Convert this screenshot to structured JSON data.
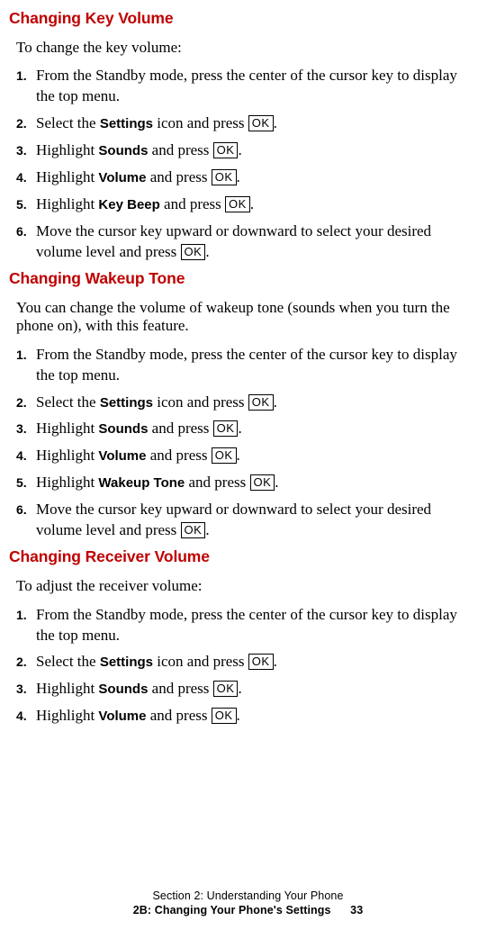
{
  "button_label": "OK",
  "sections": [
    {
      "heading": "Changing Key Volume",
      "intro": "To change the key volume:",
      "steps": [
        {
          "num": "1.",
          "parts": [
            "From the Standby mode, press the center of the cursor key to display the top menu."
          ]
        },
        {
          "num": "2.",
          "parts": [
            "Select the ",
            {
              "term": "Settings"
            },
            " icon and press ",
            {
              "ok": true
            },
            "."
          ]
        },
        {
          "num": "3.",
          "parts": [
            "Highlight ",
            {
              "term": "Sounds"
            },
            " and press ",
            {
              "ok": true
            },
            "."
          ]
        },
        {
          "num": "4.",
          "parts": [
            "Highlight ",
            {
              "term": "Volume"
            },
            " and press ",
            {
              "ok": true
            },
            "."
          ]
        },
        {
          "num": "5.",
          "parts": [
            "Highlight ",
            {
              "term": "Key Beep"
            },
            " and press ",
            {
              "ok": true
            },
            "."
          ]
        },
        {
          "num": "6.",
          "parts": [
            "Move the cursor key upward or downward to select your desired volume level and press ",
            {
              "ok": true
            },
            "."
          ]
        }
      ]
    },
    {
      "heading": "Changing Wakeup Tone",
      "intro": "You can change the volume of wakeup tone (sounds when you turn the phone on), with this feature.",
      "steps": [
        {
          "num": "1.",
          "parts": [
            "From the Standby mode, press the center of the cursor key to display the top menu."
          ]
        },
        {
          "num": "2.",
          "parts": [
            "Select the ",
            {
              "term": "Settings"
            },
            " icon and press ",
            {
              "ok": true
            },
            "."
          ]
        },
        {
          "num": "3.",
          "parts": [
            "Highlight ",
            {
              "term": "Sounds"
            },
            " and press ",
            {
              "ok": true
            },
            "."
          ]
        },
        {
          "num": "4.",
          "parts": [
            "Highlight ",
            {
              "term": "Volume"
            },
            " and press ",
            {
              "ok": true
            },
            "."
          ]
        },
        {
          "num": "5.",
          "parts": [
            "Highlight ",
            {
              "term": "Wakeup Tone"
            },
            " and press ",
            {
              "ok": true
            },
            "."
          ]
        },
        {
          "num": "6.",
          "parts": [
            "Move the cursor key upward or downward to select your desired volume level and press ",
            {
              "ok": true
            },
            "."
          ]
        }
      ]
    },
    {
      "heading": "Changing Receiver Volume",
      "intro": "To adjust the receiver volume:",
      "steps": [
        {
          "num": "1.",
          "parts": [
            "From the Standby mode, press the center of the cursor key to display the top menu."
          ]
        },
        {
          "num": "2.",
          "parts": [
            "Select the ",
            {
              "term": "Settings"
            },
            " icon and press ",
            {
              "ok": true
            },
            "."
          ]
        },
        {
          "num": "3.",
          "parts": [
            "Highlight ",
            {
              "term": "Sounds"
            },
            " and press ",
            {
              "ok": true
            },
            "."
          ]
        },
        {
          "num": "4.",
          "parts": [
            "Highlight ",
            {
              "term": "Volume"
            },
            " and press ",
            {
              "ok": true
            },
            "."
          ]
        }
      ]
    }
  ],
  "footer": {
    "line1": "Section 2: Understanding Your Phone",
    "line2": "2B: Changing Your Phone's Settings",
    "page": "33"
  }
}
